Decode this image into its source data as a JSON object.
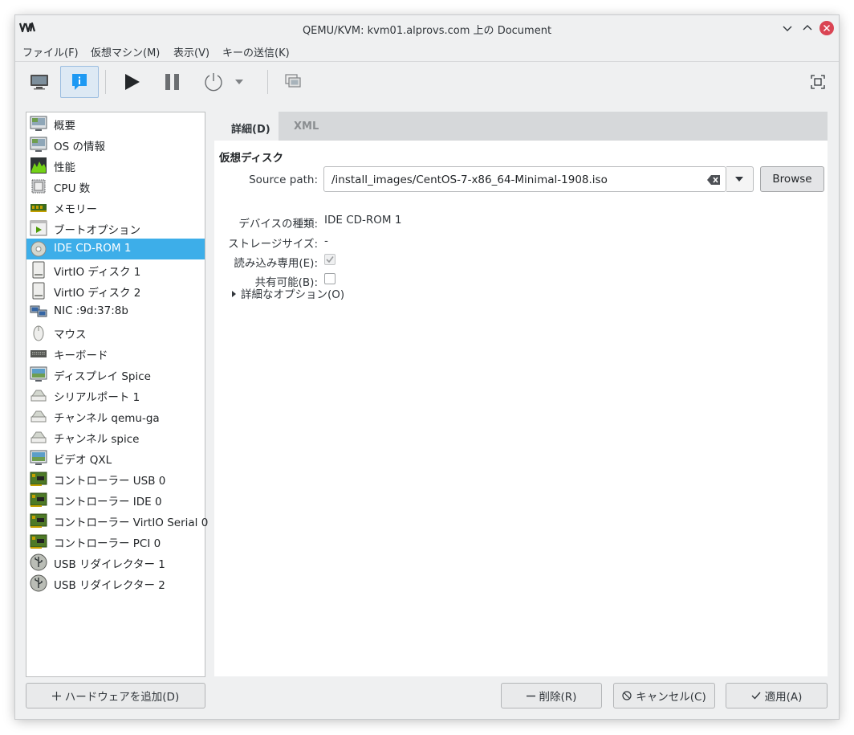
{
  "window": {
    "title": "QEMU/KVM: kvm01.alprovs.com 上の Document"
  },
  "menu": [
    {
      "label": "ファイル(F)"
    },
    {
      "label": "仮想マシン(M)"
    },
    {
      "label": "表示(V)"
    },
    {
      "label": "キーの送信(K)"
    }
  ],
  "toolbar": {
    "icons": [
      "monitor-icon",
      "info-icon",
      "play-icon",
      "pause-icon",
      "power-icon",
      "dropdown-arrow-icon",
      "snapshot-icon",
      "fullscreen-icon"
    ],
    "active": "info-icon"
  },
  "devices": [
    {
      "label": "概要",
      "icon": "overview-icon"
    },
    {
      "label": "OS の情報",
      "icon": "os-info-icon"
    },
    {
      "label": "性能",
      "icon": "performance-icon"
    },
    {
      "label": "CPU 数",
      "icon": "cpu-icon"
    },
    {
      "label": "メモリー",
      "icon": "memory-icon"
    },
    {
      "label": "ブートオプション",
      "icon": "boot-icon"
    },
    {
      "label": "IDE CD-ROM 1",
      "icon": "cdrom-icon",
      "selected": true
    },
    {
      "label": "VirtIO ディスク 1",
      "icon": "disk-icon"
    },
    {
      "label": "VirtIO ディスク 2",
      "icon": "disk-icon"
    },
    {
      "label": "NIC :9d:37:8b",
      "icon": "nic-icon"
    },
    {
      "label": "マウス",
      "icon": "mouse-icon"
    },
    {
      "label": "キーボード",
      "icon": "keyboard-icon"
    },
    {
      "label": "ディスプレイ Spice",
      "icon": "display-icon"
    },
    {
      "label": "シリアルポート 1",
      "icon": "serial-icon"
    },
    {
      "label": "チャンネル qemu-ga",
      "icon": "channel-icon"
    },
    {
      "label": "チャンネル spice",
      "icon": "channel-icon"
    },
    {
      "label": "ビデオ QXL",
      "icon": "video-icon"
    },
    {
      "label": "コントローラー USB 0",
      "icon": "controller-icon"
    },
    {
      "label": "コントローラー IDE 0",
      "icon": "controller-icon"
    },
    {
      "label": "コントローラー VirtIO Serial 0",
      "icon": "controller-icon"
    },
    {
      "label": "コントローラー PCI 0",
      "icon": "controller-icon"
    },
    {
      "label": "USB リダイレクター 1",
      "icon": "usb-icon"
    },
    {
      "label": "USB リダイレクター 2",
      "icon": "usb-icon"
    }
  ],
  "tabs": [
    {
      "label": "詳細(D)",
      "active": true
    },
    {
      "label": "XML",
      "active": false
    }
  ],
  "details": {
    "section_title": "仮想ディスク",
    "source_path_label": "Source path:",
    "source_path_value": "/install_images/CentOS-7-x86_64-Minimal-1908.iso",
    "browse_label": "Browse",
    "device_type_label": "デバイスの種類:",
    "device_type_value": "IDE CD-ROM 1",
    "storage_size_label": "ストレージサイズ:",
    "storage_size_value": "-",
    "readonly_label": "読み込み専用(E):",
    "readonly_checked": true,
    "shareable_label": "共有可能(B):",
    "shareable_checked": false,
    "advanced_label": "詳細なオプション(O)"
  },
  "buttons": {
    "add_hardware": "ハードウェアを追加(D)",
    "remove": "削除(R)",
    "cancel": "キャンセル(C)",
    "apply": "適用(A)"
  },
  "colors": {
    "selection": "#3daee9",
    "window_bg": "#eff0f1",
    "close_button": "#da4453"
  }
}
